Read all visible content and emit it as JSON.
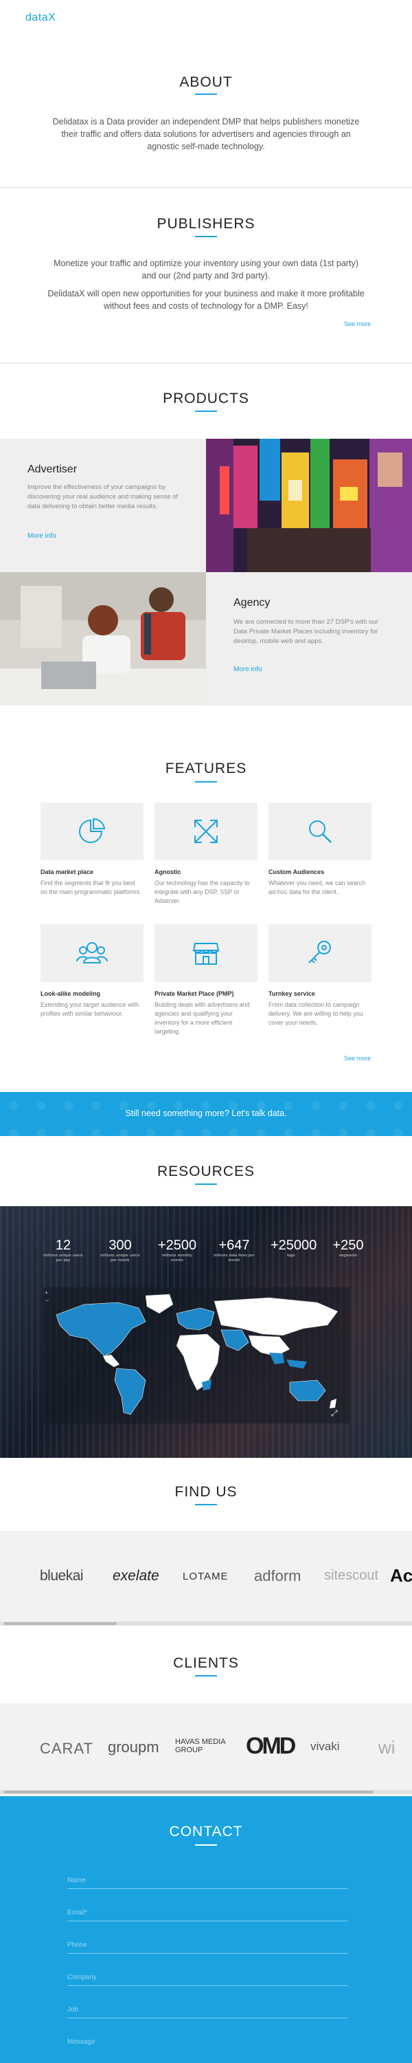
{
  "brand": {
    "logo": "dataX"
  },
  "about": {
    "title": "ABOUT",
    "text": "Delidatax is a Data provider an independent DMP that helps publishers monetize their traffic and offers data solutions for advertisers and agencies through an agnostic self-made technology."
  },
  "publishers": {
    "title": "PUBLISHERS",
    "text1": "Monetize your traffic and optimize your inventory using your own data (1st party) and our (2nd party and 3rd party).",
    "text2": "DelidataX will open new opportunities for your business and make it more profitable without fees and costs of technology for a DMP. Easy!",
    "see_more": "See more"
  },
  "products": {
    "title": "PRODUCTS",
    "advertiser": {
      "title": "Advertiser",
      "text": "Improve the effectiveness of your campaigns by discovering your real audience and making sense of data delivering to obtain better media results.",
      "link": "More info"
    },
    "agency": {
      "title": "Agency",
      "text": "We are connected to more than 27 DSP's with our Data Private Market Places including inventory for desktop, mobile web and apps.",
      "link": "More info"
    }
  },
  "features": {
    "title": "FEATURES",
    "items": [
      {
        "icon": "pie-chart-icon",
        "title": "Data market place",
        "text": "Find the segments that fit you best on the main programmatic platforms."
      },
      {
        "icon": "expand-arrows-icon",
        "title": "Agnostic",
        "text": "Our technology has the capacity to integrate with any DSP, SSP or Adserver."
      },
      {
        "icon": "search-icon",
        "title": "Custom Audiences",
        "text": "Whatever you need, we can search ad-hoc data for the client."
      },
      {
        "icon": "users-icon",
        "title": "Look-alike modeling",
        "text": "Extending your target audience with profiles with similar behaviour."
      },
      {
        "icon": "store-icon",
        "title": "Private Market Place (PMP)",
        "text": "Building deals with advertisers and agencies and qualifying your inventory for a more efficient targeting."
      },
      {
        "icon": "key-icon",
        "title": "Turnkey service",
        "text": "From data collection to campaign delivery. We are willing to help you cover your needs."
      }
    ],
    "see_more": "See more"
  },
  "banner": {
    "text": "Still need something more? Let's talk data."
  },
  "resources": {
    "title": "RESOURCES",
    "stats": [
      {
        "value": "12",
        "label": "millions unique users per day"
      },
      {
        "value": "300",
        "label": "millions unique users per month"
      },
      {
        "value": "+2500",
        "label": "millions monthly events"
      },
      {
        "value": "+647",
        "label": "millions data lines per month"
      },
      {
        "value": "+25000",
        "label": "tags"
      },
      {
        "value": "+250",
        "label": "segments"
      }
    ]
  },
  "find_us": {
    "title": "FIND US",
    "logos": [
      "bluekai",
      "exelate",
      "LOTAME",
      "adform",
      "sitescout",
      "Ac"
    ]
  },
  "clients": {
    "title": "CLIENTS",
    "logos": [
      "CARAT",
      "groupm",
      "HAVAS MEDIA GROUP",
      "OMD",
      "vivaki",
      "wi"
    ]
  },
  "contact": {
    "title": "CONTACT",
    "fields": [
      {
        "placeholder": "Name"
      },
      {
        "placeholder": "Email*"
      },
      {
        "placeholder": "Phone"
      },
      {
        "placeholder": "Company"
      },
      {
        "placeholder": "Job"
      },
      {
        "placeholder": "Message"
      }
    ]
  },
  "colors": {
    "accent": "#1aa3e0",
    "gray_bg": "#efefef"
  }
}
